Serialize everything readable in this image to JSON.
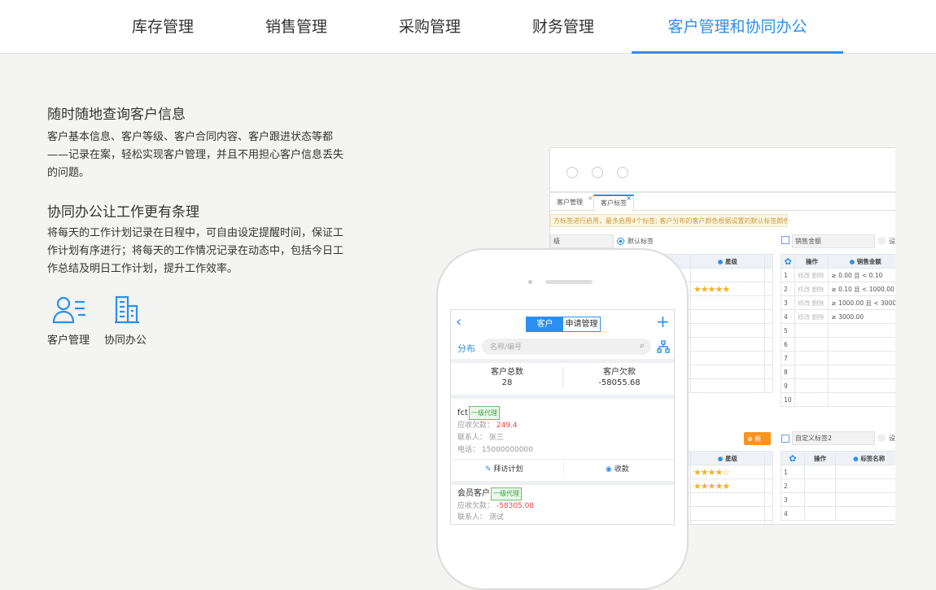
{
  "nav": {
    "tabs": [
      "库存管理",
      "销售管理",
      "采购管理",
      "财务管理",
      "客户管理和协同办公"
    ],
    "active": 4,
    "accent": "#2b8ff0"
  },
  "left": {
    "h1": "随时随地查询客户信息",
    "p1": "客户基本信息、客户等级、客户合同内容、客户跟进状态等都——记录在案，轻松实现客户管理，并且不用担心客户信息丢失的问题。",
    "h2": "协同办公让工作更有条理",
    "p2": "将每天的工作计划记录在日程中，可自由设定提醒时间，保证工作计划有序进行；将每天的工作情况记录在动态中，包括今日工作总结及明日工作计划，提升工作效率。",
    "icons": [
      {
        "label": "客户管理",
        "icon": "customer-icon"
      },
      {
        "label": "协同办公",
        "icon": "office-building-icon"
      }
    ]
  },
  "desktop": {
    "tabs": [
      "客户管理",
      "客户标签"
    ],
    "notice": "方标签进行启用，最多启用4个标签; 客户分布的客户颜色根据设置的默认标签颜色显示",
    "default_tag": "默认标签",
    "left_prefix": "级",
    "star_header": "星级",
    "input1": "销售金额",
    "radio_trunc": "设",
    "col_op": "操作",
    "col_amount": "销售金额",
    "edit": "修改",
    "del": "删除",
    "rows1": [
      "≥ 0.00 且 < 0.10",
      "≥ 0.10 且 < 1000.00",
      "≥ 1000.00 且 < 3000",
      "≥ 3000.00",
      "",
      "",
      "",
      "",
      "",
      ""
    ],
    "add": "新增",
    "input2": "自定义标签2",
    "col_tagname": "标签名称",
    "rows2": [
      "1",
      "2",
      "3",
      "4"
    ]
  },
  "phone": {
    "seg": [
      "客户",
      "申请管理"
    ],
    "dist": "分布",
    "search_placeholder": "名称/编号",
    "total_label": "客户总数",
    "total": "28",
    "debt_label": "客户欠款",
    "debt": "-58055.68",
    "customers": [
      {
        "name": "fct",
        "badge": "一级代理",
        "recv_label": "应收欠款：",
        "recv": "249.4",
        "contact_label": "联系人：",
        "contact": "张三",
        "phone_label": "电话：",
        "phone": "15000000000"
      },
      {
        "name": "会员客户",
        "badge": "一级代理",
        "recv_label": "应收欠款：",
        "recv": "-58305.08",
        "contact_label": "联系人：",
        "contact": "测试"
      }
    ],
    "visit": "拜访计划",
    "collect": "收款"
  }
}
